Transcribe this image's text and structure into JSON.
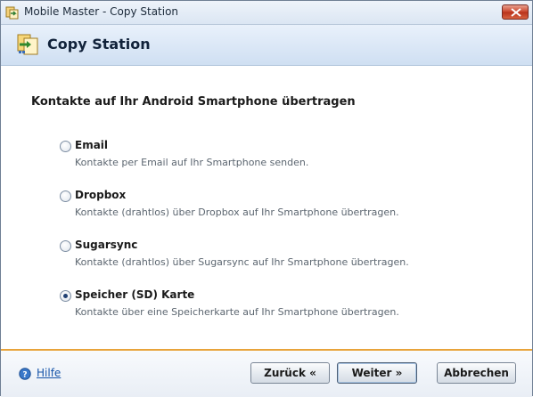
{
  "window": {
    "title": "Mobile Master - Copy Station",
    "icon": "copy-station-app-icon",
    "close_icon": "close-icon"
  },
  "banner": {
    "title": "Copy Station",
    "icon": "copy-station-banner-icon"
  },
  "content": {
    "heading": "Kontakte auf Ihr Android Smartphone übertragen",
    "options": [
      {
        "label": "Email",
        "description": "Kontakte per Email auf Ihr Smartphone senden.",
        "checked": false
      },
      {
        "label": "Dropbox",
        "description": "Kontakte (drahtlos) über Dropbox auf Ihr Smartphone übertragen.",
        "checked": false
      },
      {
        "label": "Sugarsync",
        "description": "Kontakte (drahtlos) über Sugarsync auf Ihr Smartphone übertragen.",
        "checked": false
      },
      {
        "label": "Speicher (SD) Karte",
        "description": "Kontakte über eine Speicherkarte auf Ihr Smartphone übertragen.",
        "checked": true
      }
    ]
  },
  "footer": {
    "help_label": "Hilfe",
    "back_label": "Zurück «",
    "next_label": "Weiter »",
    "cancel_label": "Abbrechen"
  },
  "colors": {
    "footer_accent": "#e8a33a",
    "link": "#1553a8",
    "close_button": "#c9432a"
  }
}
